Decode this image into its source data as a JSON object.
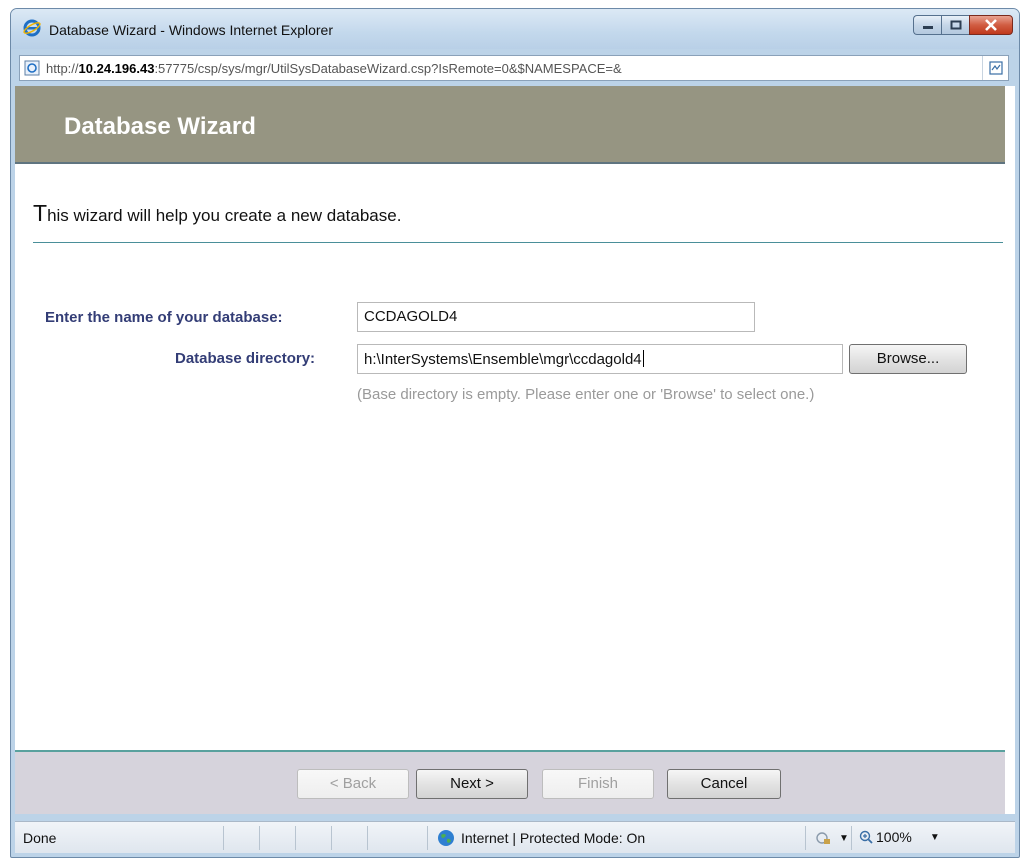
{
  "window": {
    "title": "Database Wizard - Windows Internet Explorer",
    "controls": [
      "minimize-icon",
      "maximize-icon",
      "close-icon"
    ]
  },
  "address_bar": {
    "url_prefix": "http://",
    "url_host": "10.24.196.43",
    "url_rest": ":57775/csp/sys/mgr/UtilSysDatabaseWizard.csp?IsRemote=0&$NAMESPACE=&"
  },
  "wizard": {
    "title": "Database Wizard",
    "intro_first_letter": "T",
    "intro_rest": "his wizard will help you create a new database.",
    "name_label": "Enter the name of your database:",
    "name_value": "CCDAGOLD4",
    "dir_label": "Database directory:",
    "dir_value": "h:\\InterSystems\\Ensemble\\mgr\\ccdagold4",
    "browse_label": "Browse...",
    "hint": "(Base directory is empty. Please enter one or 'Browse' to select one.)"
  },
  "footer": {
    "back_label": "< Back",
    "back_enabled": false,
    "next_label": "Next >",
    "finish_label": "Finish",
    "finish_enabled": false,
    "cancel_label": "Cancel"
  },
  "status_bar": {
    "status": "Done",
    "zone": "Internet | Protected Mode: On",
    "zoom": "100%"
  },
  "colors": {
    "header_bg": "#969582",
    "label_text": "#333d76",
    "accent_rule": "#4a8f99"
  }
}
